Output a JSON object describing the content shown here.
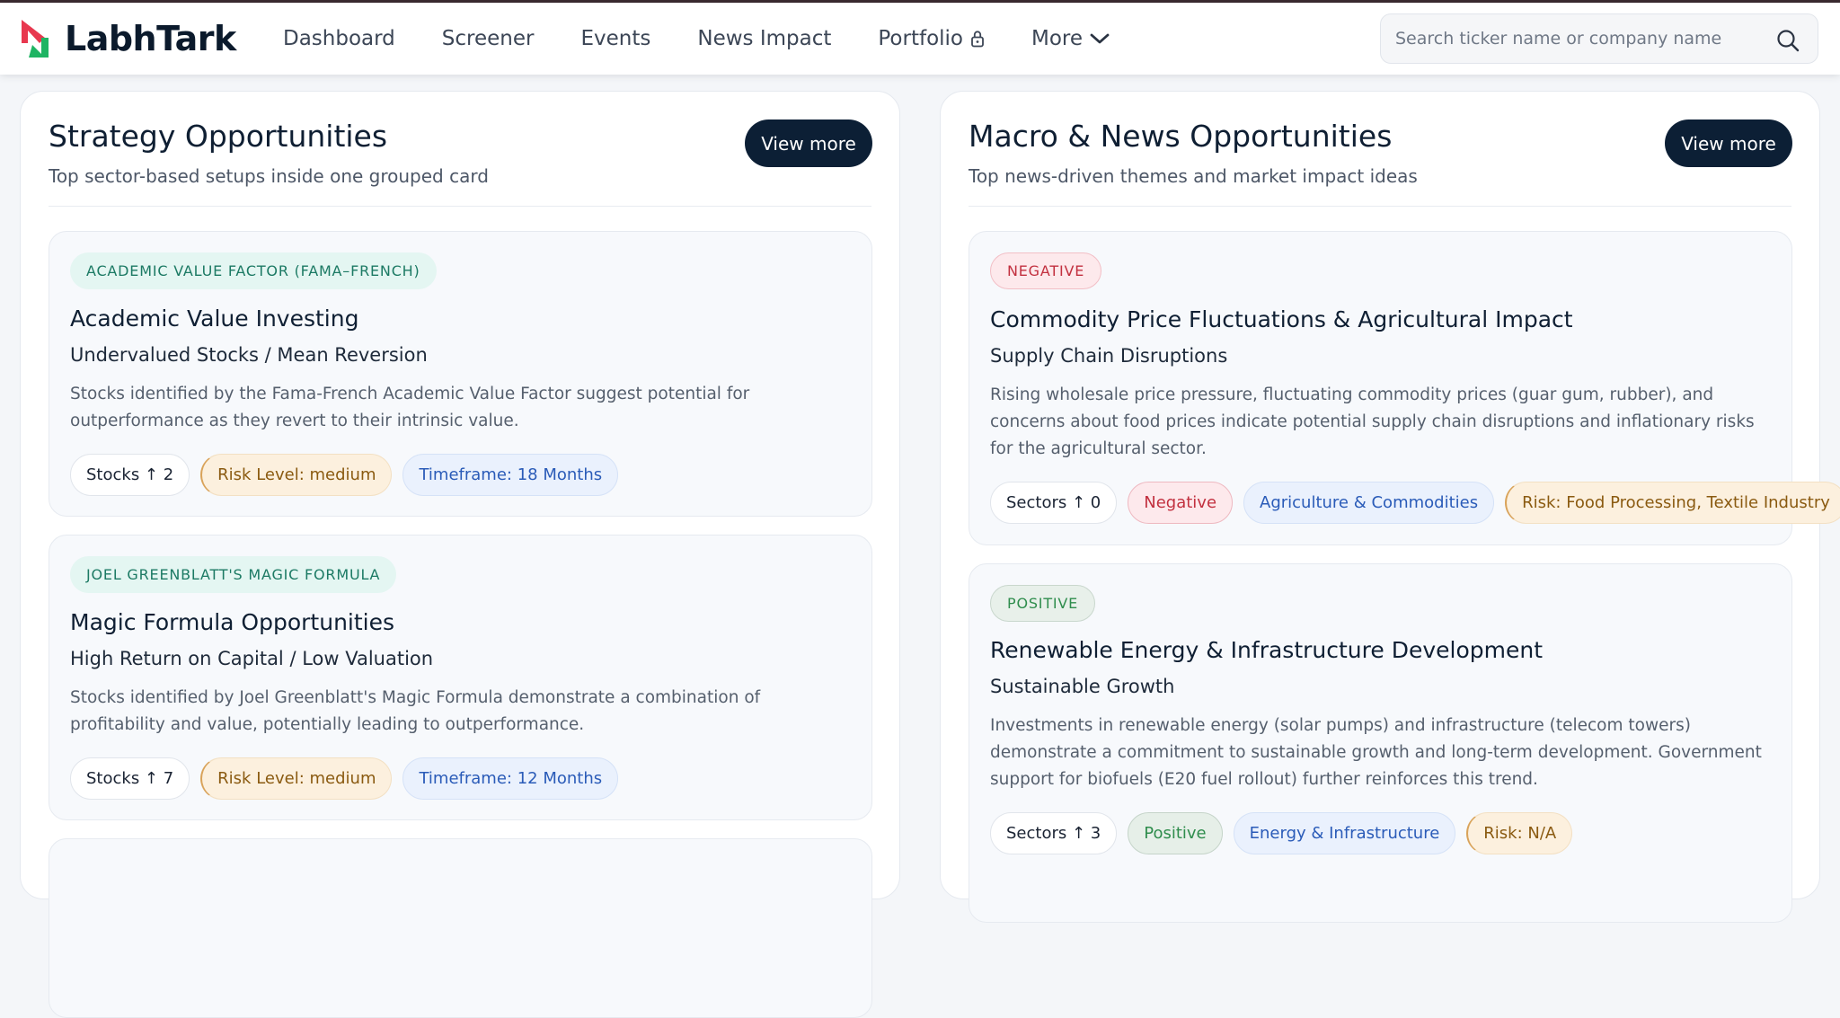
{
  "brand": {
    "name": "LabhTark"
  },
  "nav": {
    "items": [
      "Dashboard",
      "Screener",
      "Events",
      "News Impact",
      "Portfolio",
      "More"
    ]
  },
  "search": {
    "placeholder": "Search ticker name or company name"
  },
  "colors": {
    "brand_red": "#e8384f",
    "brand_green": "#1fb463",
    "primary_button": "#0c1f35"
  },
  "strategy": {
    "title": "Strategy Opportunities",
    "subtitle": "Top sector-based setups inside one grouped card",
    "view_more": "View more",
    "cards": [
      {
        "tag": "ACADEMIC VALUE FACTOR (FAMA–FRENCH)",
        "title": "Academic Value Investing",
        "subtitle": "Undervalued Stocks / Mean Reversion",
        "description": "Stocks identified by the Fama-French Academic Value Factor suggest potential for outperformance as they revert to their intrinsic value.",
        "chips": {
          "count": "Stocks ↑ 2",
          "risk": "Risk Level: medium",
          "timeframe": "Timeframe: 18 Months"
        }
      },
      {
        "tag": "JOEL GREENBLATT'S MAGIC FORMULA",
        "title": "Magic Formula Opportunities",
        "subtitle": "High Return on Capital / Low Valuation",
        "description": "Stocks identified by Joel Greenblatt's Magic Formula demonstrate a combination of profitability and value, potentially leading to outperformance.",
        "chips": {
          "count": "Stocks ↑ 7",
          "risk": "Risk Level: medium",
          "timeframe": "Timeframe: 12 Months"
        }
      }
    ]
  },
  "macro": {
    "title": "Macro & News Opportunities",
    "subtitle": "Top news-driven themes and market impact ideas",
    "view_more": "View more",
    "cards": [
      {
        "tag": "NEGATIVE",
        "title": "Commodity Price Fluctuations & Agricultural Impact",
        "subtitle": "Supply Chain Disruptions",
        "description": "Rising wholesale price pressure, fluctuating commodity prices (guar gum, rubber), and concerns about food prices indicate potential supply chain disruptions and inflationary risks for the agricultural sector.",
        "chips": {
          "count": "Sectors ↑ 0",
          "sentiment": "Negative",
          "sector": "Agriculture & Commodities",
          "risk": "Risk: Food Processing, Textile Industry"
        }
      },
      {
        "tag": "POSITIVE",
        "title": "Renewable Energy & Infrastructure Development",
        "subtitle": "Sustainable Growth",
        "description": "Investments in renewable energy (solar pumps) and infrastructure (telecom towers) demonstrate a commitment to sustainable growth and long-term development. Government support for biofuels (E20 fuel rollout) further reinforces this trend.",
        "chips": {
          "count": "Sectors ↑ 3",
          "sentiment": "Positive",
          "sector": "Energy & Infrastructure",
          "risk": "Risk: N/A"
        }
      }
    ]
  }
}
